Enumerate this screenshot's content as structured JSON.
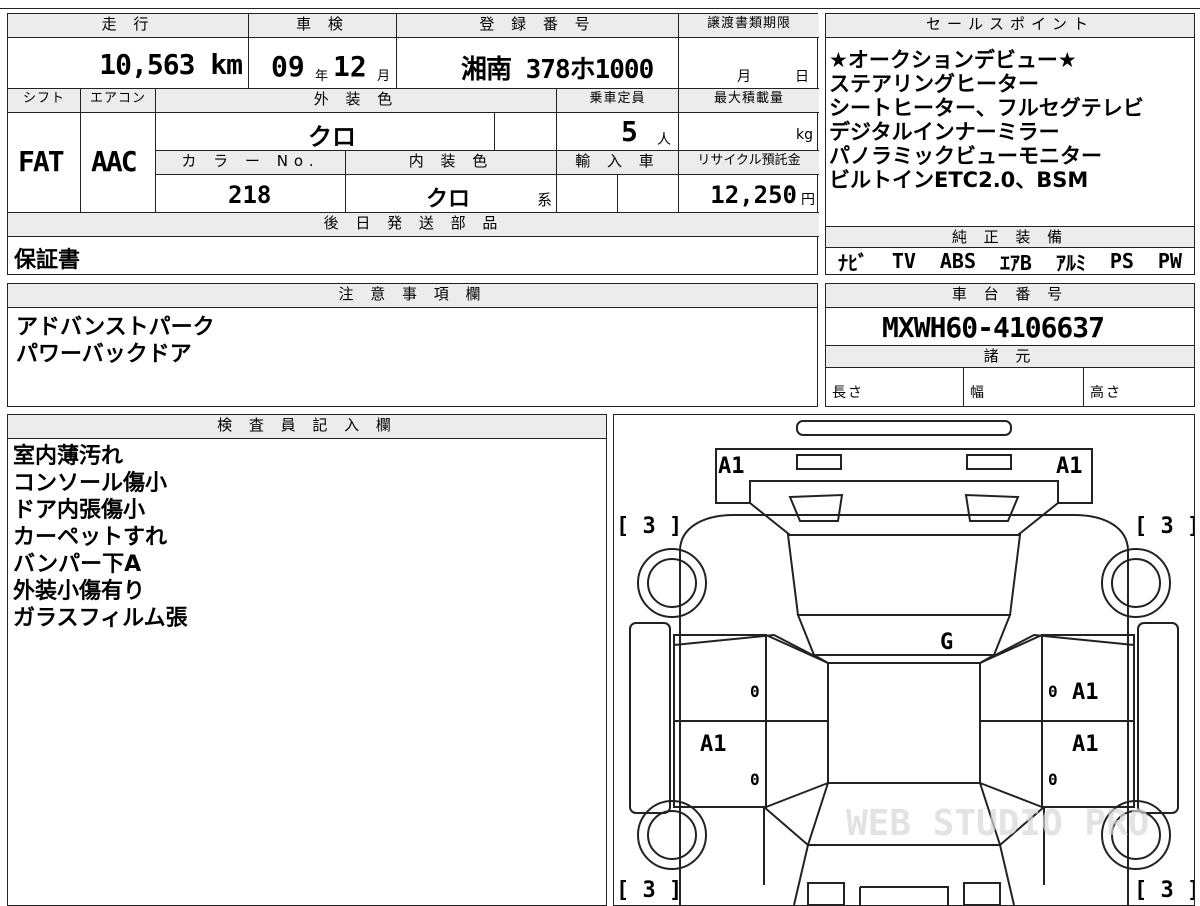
{
  "top_table": {
    "mileage_label": "走 行",
    "mileage_value": "10,563 km",
    "inspection_label": "車 検",
    "inspection_year": "09",
    "inspection_year_unit": "年",
    "inspection_month": "12",
    "inspection_month_unit": "月",
    "registration_label": "登 録 番 号",
    "registration_value": "湘南 378ホ1000",
    "transfer_docs_label": "譲渡書類期限",
    "transfer_docs_month": "月",
    "transfer_docs_day": "日",
    "shift_label": "シフト",
    "shift_value": "FAT",
    "aircon_label": "エアコン",
    "aircon_value": "AAC",
    "exterior_color_label": "外 装 色",
    "exterior_color_value": "クロ",
    "capacity_label": "乗車定員",
    "capacity_value": "5",
    "capacity_unit": "人",
    "max_load_label": "最大積載量",
    "max_load_unit": "kg",
    "color_no_label": "カ ラ ー No.",
    "color_no_value": "218",
    "interior_color_label": "内 装 色",
    "interior_color_value": "クロ",
    "interior_color_suffix": "系",
    "import_label": "輸 入 車",
    "recycle_label": "リサイクル預託金",
    "recycle_value": "12,250",
    "recycle_unit": "円",
    "later_parts_label": "後 日 発 送 部 品",
    "later_parts_value": "保証書"
  },
  "sales_points": {
    "label": "セールスポイント",
    "lines": [
      "★オークションデビュー★",
      "ステアリングヒーター",
      "シートヒーター、フルセグテレビ",
      "デジタルインナーミラー",
      "パノラミックビューモニター",
      "ビルトインETC2.0、BSM"
    ]
  },
  "equipment": {
    "label": "純 正 装 備",
    "items": [
      "ﾅﾋﾞ",
      "TV",
      "ABS",
      "ｴｱB",
      "ｱﾙﾐ",
      "PS",
      "PW"
    ]
  },
  "notes": {
    "label": "注 意 事 項 欄",
    "lines": [
      "アドバンストパーク",
      "パワーバックドア"
    ]
  },
  "chassis": {
    "label": "車 台 番 号",
    "value": "MXWH60-4106637",
    "specs_label": "諸 元",
    "length_label": "長さ",
    "width_label": "幅",
    "height_label": "高さ"
  },
  "inspector": {
    "label": "検 査 員 記 入 欄",
    "lines": [
      "室内薄汚れ",
      "コンソール傷小",
      "ドア内張傷小",
      "カーペットすれ",
      "バンパー下A",
      "外装小傷有り",
      "ガラスフィルム張"
    ]
  },
  "diagram": {
    "marks": {
      "front_left": "A1",
      "front_right": "A1",
      "windshield": "G",
      "front_door_right": "A1",
      "rear_door_left": "A1",
      "rear_door_right": "A1",
      "tire_front_left": "[ 3 ]",
      "tire_front_right": "[ 3 ]",
      "tire_rear_left": "[ 3 ]",
      "tire_rear_right": "[ 3 ]",
      "door_small_1": "0",
      "door_small_2": "0",
      "door_small_3": "0",
      "door_small_4": "0"
    },
    "watermark": "WEB STUDIO PRO"
  }
}
